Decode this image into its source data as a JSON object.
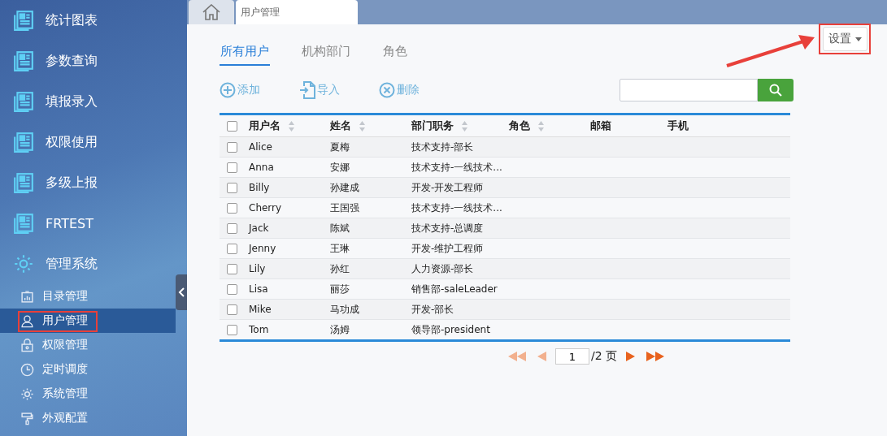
{
  "sidebar": {
    "items": [
      {
        "label": "统计图表",
        "kind": "report"
      },
      {
        "label": "参数查询",
        "kind": "report"
      },
      {
        "label": "填报录入",
        "kind": "report"
      },
      {
        "label": "权限使用",
        "kind": "report"
      },
      {
        "label": "多级上报",
        "kind": "report"
      },
      {
        "label": "FRTEST",
        "kind": "report"
      },
      {
        "label": "管理系统",
        "kind": "gear",
        "children": [
          {
            "label": "目录管理",
            "kind": "chart",
            "selected": false,
            "highlighted": false
          },
          {
            "label": "用户管理",
            "kind": "user",
            "selected": true,
            "highlighted": true
          },
          {
            "label": "权限管理",
            "kind": "lock",
            "selected": false,
            "highlighted": false
          },
          {
            "label": "定时调度",
            "kind": "clock",
            "selected": false,
            "highlighted": false
          },
          {
            "label": "系统管理",
            "kind": "gear",
            "selected": false,
            "highlighted": false
          },
          {
            "label": "外观配置",
            "kind": "roller",
            "selected": false,
            "highlighted": false
          }
        ]
      }
    ]
  },
  "page_tabs": [
    {
      "kind": "home",
      "selected": false
    },
    {
      "kind": "text",
      "label": "用户管理",
      "selected": true
    }
  ],
  "settings_button": {
    "label": "设置",
    "highlighted": true
  },
  "subtabs": [
    {
      "label": "所有用户",
      "selected": true
    },
    {
      "label": "机构部门",
      "selected": false
    },
    {
      "label": "角色",
      "selected": false
    }
  ],
  "toolbar": [
    {
      "label": "添加",
      "kind": "add"
    },
    {
      "label": "导入",
      "kind": "import"
    },
    {
      "label": "删除",
      "kind": "delete"
    }
  ],
  "table": {
    "columns": [
      {
        "label": "用户名",
        "sortable": true
      },
      {
        "label": "姓名",
        "sortable": true
      },
      {
        "label": "部门职务",
        "sortable": true
      },
      {
        "label": "角色",
        "sortable": true
      },
      {
        "label": "邮箱",
        "sortable": false
      },
      {
        "label": "手机",
        "sortable": false
      }
    ],
    "header_checked": false,
    "rows": [
      {
        "checked": false,
        "cells": [
          "Alice",
          "夏梅",
          "技术支持-部长"
        ]
      },
      {
        "checked": false,
        "cells": [
          "Anna",
          "安娜",
          "技术支持-一线技术..."
        ]
      },
      {
        "checked": false,
        "cells": [
          "Billy",
          "孙建成",
          "开发-开发工程师"
        ]
      },
      {
        "checked": false,
        "cells": [
          "Cherry",
          "王国强",
          "技术支持-一线技术..."
        ]
      },
      {
        "checked": false,
        "cells": [
          "Jack",
          "陈斌",
          "技术支持-总调度"
        ]
      },
      {
        "checked": false,
        "cells": [
          "Jenny",
          "王琳",
          "开发-维护工程师"
        ]
      },
      {
        "checked": false,
        "cells": [
          "Lily",
          "孙红",
          "人力资源-部长"
        ]
      },
      {
        "checked": false,
        "cells": [
          "Lisa",
          "丽莎",
          "销售部-saleLeader"
        ]
      },
      {
        "checked": false,
        "cells": [
          "Mike",
          "马功成",
          "开发-部长"
        ]
      },
      {
        "checked": false,
        "cells": [
          "Tom",
          "汤姆",
          "领导部-president"
        ]
      }
    ]
  },
  "pager": {
    "first_disabled": true,
    "prev_disabled": true,
    "page": "1",
    "total": "/2 页",
    "next_disabled": false,
    "last_disabled": false
  }
}
